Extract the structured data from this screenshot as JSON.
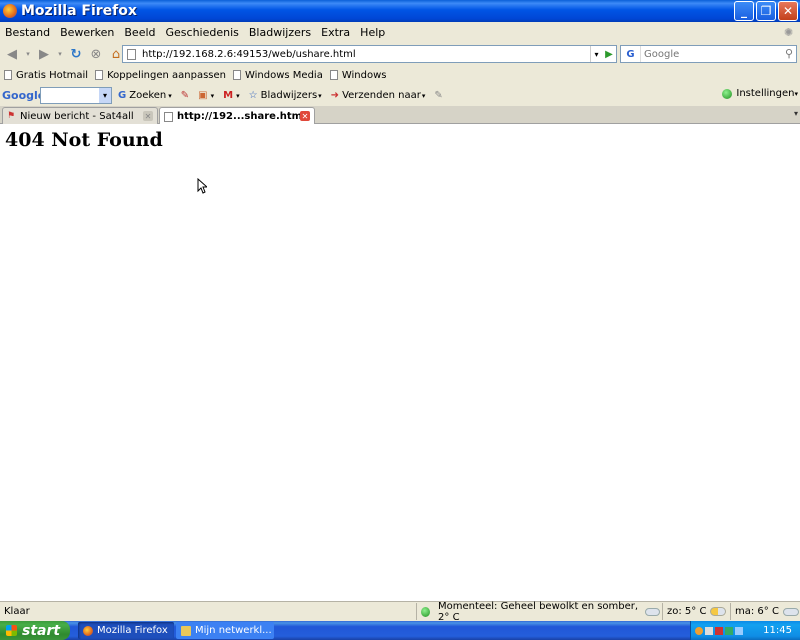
{
  "window": {
    "title": "Mozilla Firefox"
  },
  "menu": [
    "Bestand",
    "Bewerken",
    "Beeld",
    "Geschiedenis",
    "Bladwijzers",
    "Extra",
    "Help"
  ],
  "navbar": {
    "url": "http://192.168.2.6:49153/web/ushare.html",
    "search_engine": "G",
    "search_placeholder": "Google"
  },
  "bookmarks": [
    "Gratis Hotmail",
    "Koppelingen aanpassen",
    "Windows Media",
    "Windows"
  ],
  "google_toolbar": {
    "logo": "Google",
    "search_label": "Zoeken",
    "bookmarks_label": "Bladwijzers",
    "send_label": "Verzenden naar",
    "settings_label": "Instellingen"
  },
  "tabs": [
    {
      "label": "Nieuw bericht - Sat4all",
      "active": false
    },
    {
      "label": "http://192...share.html",
      "active": true
    }
  ],
  "content": {
    "heading": "404 Not Found"
  },
  "statusbar": {
    "status": "Klaar",
    "weather_now": "Momenteel: Geheel bewolkt en somber, 2° C",
    "weather_sun": "zo: 5° C",
    "weather_mon": "ma: 6° C"
  },
  "taskbar": {
    "start_label": "start",
    "tasks": [
      "Mozilla Firefox",
      "Mijn netwerkl..."
    ],
    "clock": "11:45"
  },
  "colors": {
    "titlebar": "#0055e5",
    "taskbar": "#245edb",
    "start": "#3c9b3c"
  }
}
